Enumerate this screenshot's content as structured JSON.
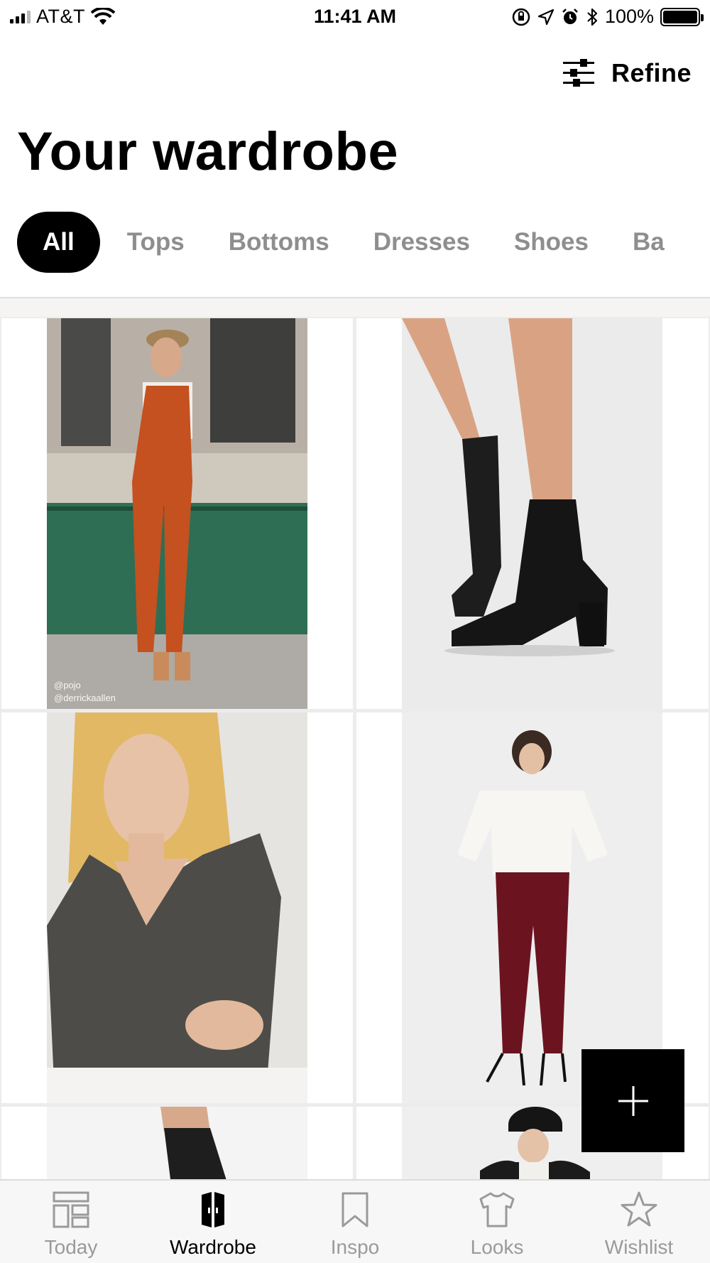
{
  "status_bar": {
    "carrier": "AT&T",
    "time": "11:41 AM",
    "battery": "100%"
  },
  "header": {
    "refine_label": "Refine",
    "title": "Your wardrobe"
  },
  "categories": {
    "selected": "All",
    "items": [
      "All",
      "Tops",
      "Bottoms",
      "Dresses",
      "Shoes",
      "Ba"
    ]
  },
  "grid": {
    "items": [
      {
        "name": "orange-jumpsuit",
        "credit_line1": "@pojo",
        "credit_line2": "@derrickaallen"
      },
      {
        "name": "black-ankle-boots"
      },
      {
        "name": "grey-v-neck-sweater"
      },
      {
        "name": "burgundy-houndstooth-trousers"
      },
      {
        "name": "black-tights"
      },
      {
        "name": "black-puffer-jacket"
      }
    ]
  },
  "tabs": {
    "selected": "Wardrobe",
    "items": [
      {
        "label": "Today",
        "icon": "today-icon"
      },
      {
        "label": "Wardrobe",
        "icon": "wardrobe-icon"
      },
      {
        "label": "Inspo",
        "icon": "bookmark-icon"
      },
      {
        "label": "Looks",
        "icon": "shirt-icon"
      },
      {
        "label": "Wishlist",
        "icon": "star-icon"
      }
    ]
  },
  "colors": {
    "accent": "#000000",
    "inactive_text": "#8e8e8e",
    "tab_inactive": "#9a9a9a",
    "tab_bar_bg": "#f7f7f7"
  }
}
